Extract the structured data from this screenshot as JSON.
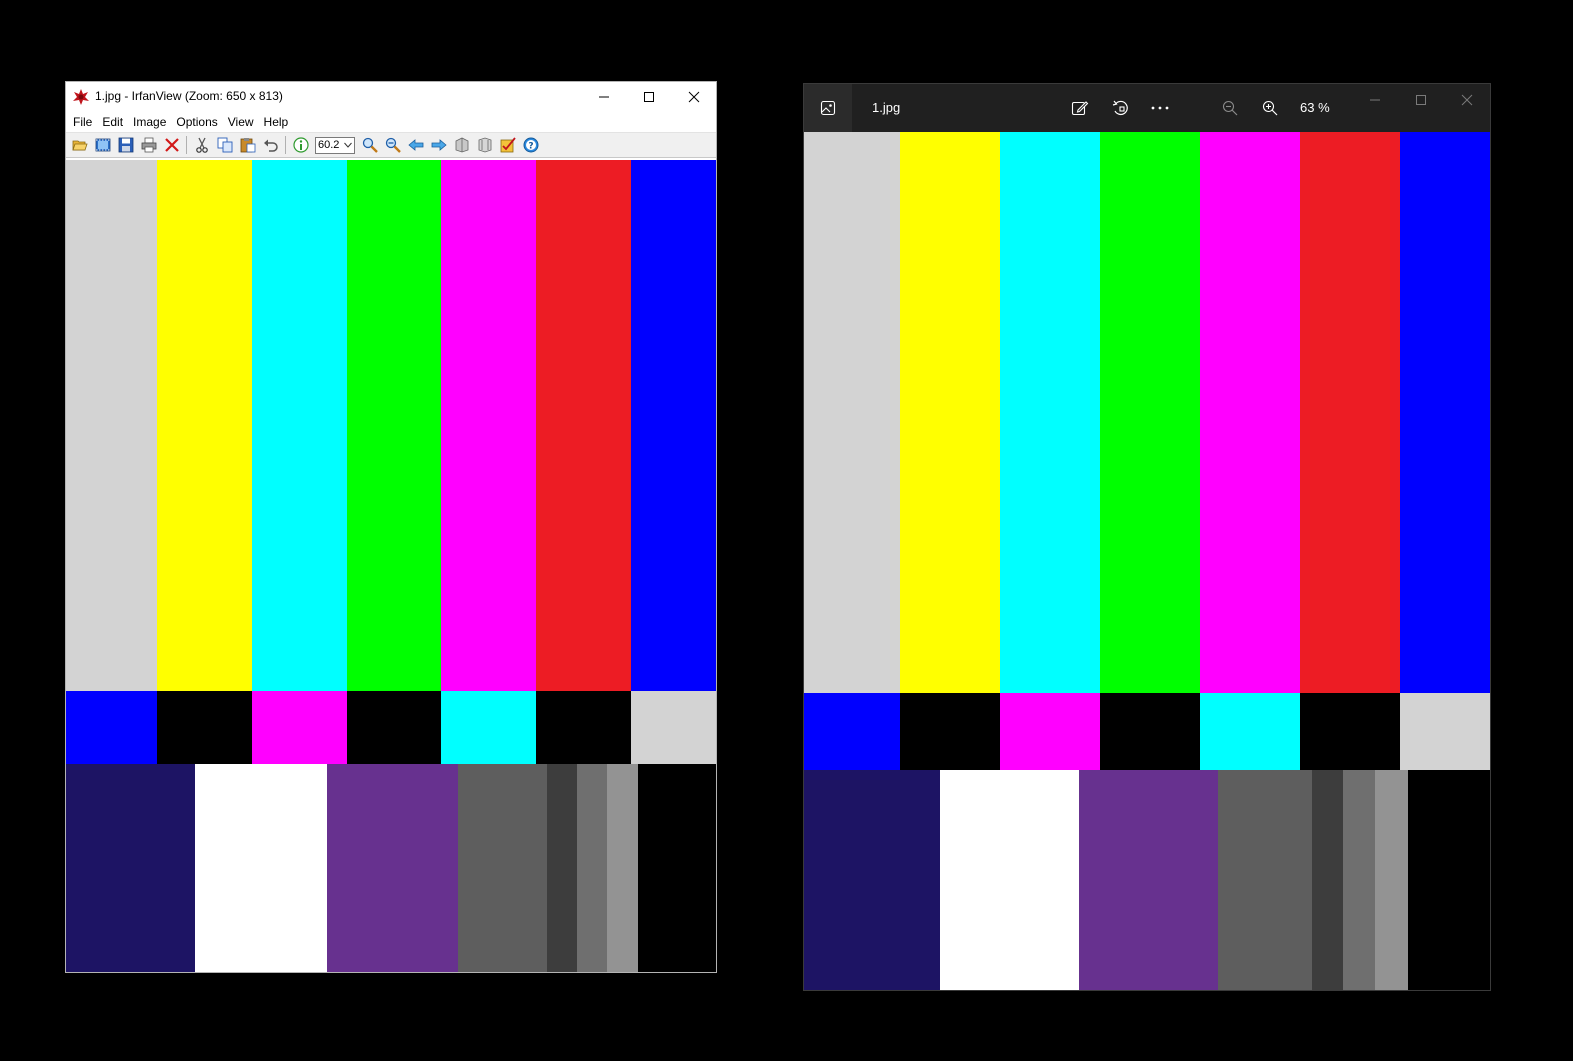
{
  "irfanview": {
    "title": "1.jpg - IrfanView (Zoom: 650 x 813)",
    "menu": [
      "File",
      "Edit",
      "Image",
      "Options",
      "View",
      "Help"
    ],
    "zoom_value": "60.2",
    "toolbar_icons": [
      "open-folder-icon",
      "slideshow-icon",
      "save-icon",
      "print-icon",
      "delete-icon",
      "cut-icon",
      "copy-icon",
      "paste-icon",
      "undo-icon",
      "info-icon",
      "zoom-in-icon",
      "zoom-out-icon",
      "previous-icon",
      "next-icon",
      "first-icon",
      "last-icon",
      "settings-icon",
      "help-icon"
    ]
  },
  "photos": {
    "file_name": "1.jpg",
    "zoom_percent": "63 %",
    "icons": [
      "gallery-icon",
      "edit-icon",
      "rotate-icon",
      "more-icon",
      "zoom-out-icon",
      "zoom-in-icon",
      "minimize-icon",
      "maximize-icon",
      "close-icon"
    ]
  },
  "test_pattern": {
    "top_bars": [
      "#d3d3d3",
      "#ffff00",
      "#00ffff",
      "#00ff00",
      "#ff00ff",
      "#ed1c24",
      "#0000ff"
    ],
    "middle_bars": [
      "#0000ff",
      "#000000",
      "#ff00ff",
      "#000000",
      "#00ffff",
      "#000000",
      "#d3d3d3"
    ],
    "bottom_bars": [
      "#1d1464",
      "#ffffff",
      "#67318f",
      "#5e5e5e",
      "#3d3d3d",
      "#6f6f6f",
      "#939393",
      "#000000"
    ]
  }
}
